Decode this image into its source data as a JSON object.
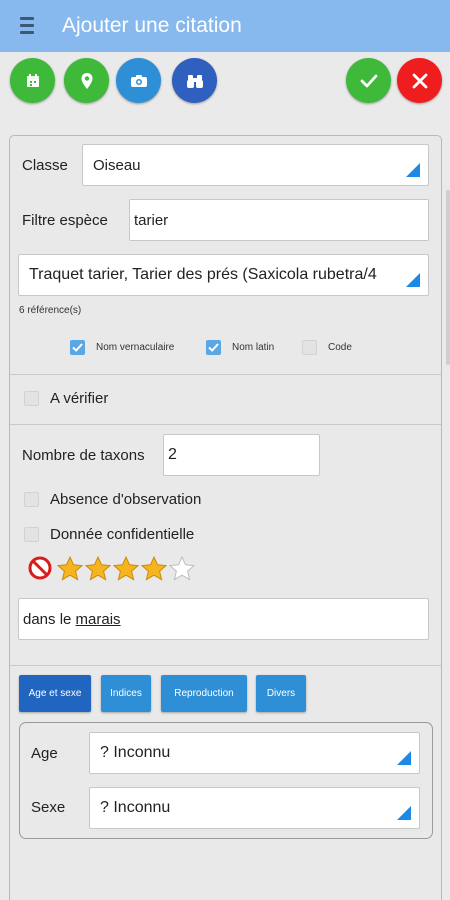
{
  "header": {
    "title": "Ajouter une citation",
    "menu_icon": "menu-icon"
  },
  "toolbar": {
    "buttons": [
      {
        "name": "calendar-button",
        "icon": "calendar-icon",
        "color": "#3fb93a"
      },
      {
        "name": "location-button",
        "icon": "location-pin-icon",
        "color": "#3fb93a"
      },
      {
        "name": "camera-button",
        "icon": "camera-icon",
        "color": "#2f8fd6"
      },
      {
        "name": "binoculars-button",
        "icon": "binoculars-icon",
        "color": "#2f5fbf"
      },
      {
        "name": "confirm-button",
        "icon": "check-icon",
        "color": "#3fb93a"
      },
      {
        "name": "cancel-button",
        "icon": "close-icon",
        "color": "#ef1d1d"
      }
    ]
  },
  "form": {
    "classe_label": "Classe",
    "classe_value": "Oiseau",
    "filter_label": "Filtre espèce",
    "filter_value": "tarier",
    "species_value": "Traquet tarier, Tarier des prés (Saxicola rubetra/4",
    "references": "6 référence(s)",
    "options": [
      {
        "label": "Nom vernaculaire",
        "checked": true
      },
      {
        "label": "Nom latin",
        "checked": true
      },
      {
        "label": "Code",
        "checked": false
      }
    ],
    "verify_label": "A vérifier",
    "taxa_count_label": "Nombre de taxons",
    "taxa_count_value": "2",
    "absence_label": "Absence d'observation",
    "confidential_label": "Donnée confidentielle",
    "rating": 4,
    "rating_max": 5,
    "comment_prefix": "dans le ",
    "comment_link": "marais"
  },
  "tabs": [
    {
      "label": "Age et sexe",
      "active": true
    },
    {
      "label": "Indices",
      "active": false
    },
    {
      "label": "Reproduction",
      "active": false
    },
    {
      "label": "Divers",
      "active": false
    }
  ],
  "details": {
    "age_label": "Age",
    "age_value": "? Inconnu",
    "sex_label": "Sexe",
    "sex_value": "? Inconnu"
  },
  "colors": {
    "appbar": "#87b9ee",
    "accent": "#1e88e5",
    "tab_active": "#2065c0",
    "tab_inactive": "#2f8fd6",
    "star": "#f6b51e"
  }
}
